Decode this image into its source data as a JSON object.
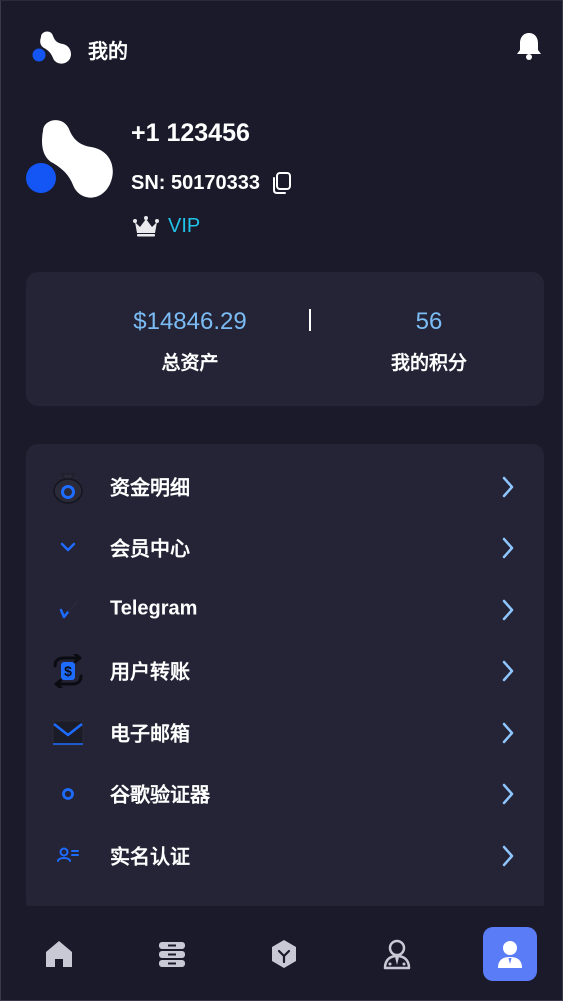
{
  "header": {
    "title": "我的"
  },
  "profile": {
    "phone": "+1 123456",
    "sn": "SN: 50170333",
    "vip": "VIP"
  },
  "stats": {
    "total_assets_value": "$14846.29",
    "total_assets_label": "总资产",
    "points_value": "56",
    "points_label": "我的积分"
  },
  "menu": {
    "items": [
      {
        "label": "资金明细",
        "icon": "money-bag-icon"
      },
      {
        "label": "会员中心",
        "icon": "chevron-badge-icon"
      },
      {
        "label": "Telegram",
        "icon": "telegram-icon"
      },
      {
        "label": "用户转账",
        "icon": "transfer-icon"
      },
      {
        "label": "电子邮箱",
        "icon": "mail-icon"
      },
      {
        "label": "谷歌验证器",
        "icon": "authenticator-icon"
      },
      {
        "label": "实名认证",
        "icon": "id-card-icon"
      }
    ]
  },
  "nav": {
    "items": [
      {
        "icon": "home-icon"
      },
      {
        "icon": "server-icon"
      },
      {
        "icon": "cube-icon"
      },
      {
        "icon": "agent-icon"
      },
      {
        "icon": "user-icon",
        "active": true
      }
    ]
  },
  "colors": {
    "background": "#1a1a2b",
    "card": "#242436",
    "accent_blue": "#7bbcf5",
    "vip_cyan": "#21c3e8",
    "active_nav": "#5b7cf7",
    "brand_blue": "#1456f5"
  }
}
